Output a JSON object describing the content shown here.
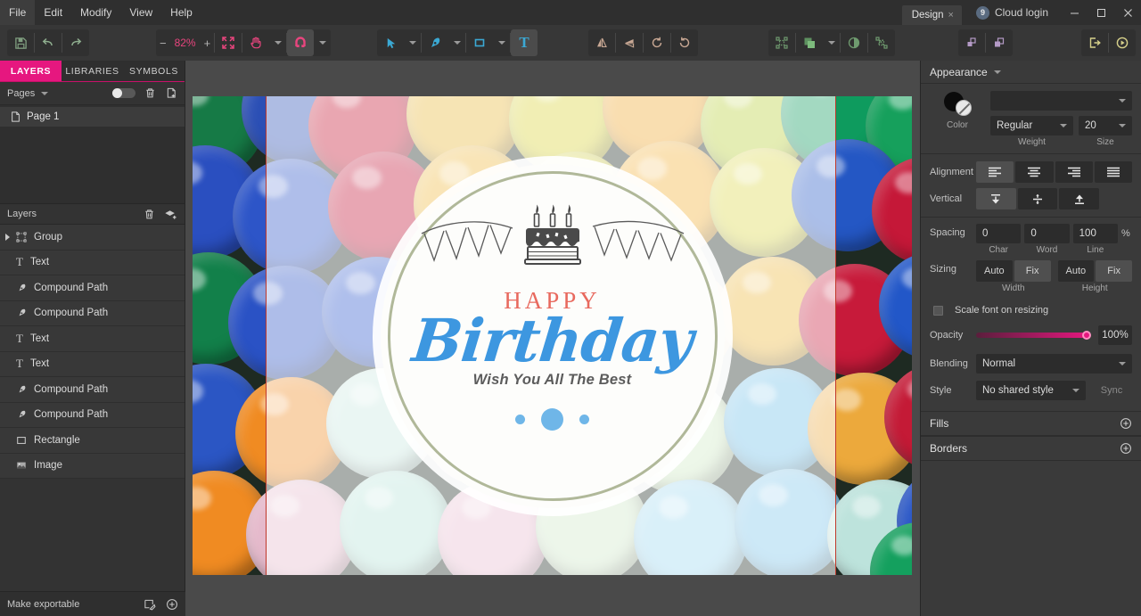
{
  "menu": {
    "items": [
      "File",
      "Edit",
      "Modify",
      "View",
      "Help"
    ],
    "design_tab": "Design",
    "design_tab_close": "×",
    "cloud_login": "Cloud login",
    "cloud_badge": "9",
    "minimize": "—",
    "maximize": "☐",
    "close": "✕"
  },
  "toolbar": {
    "save_icon": "save-icon",
    "undo_icon": "undo-icon",
    "redo_icon": "redo-icon",
    "zoom_minus": "−",
    "zoom_value": "82%",
    "zoom_plus": "+",
    "fit_icon": "fit-to-screen-icon",
    "hand_icon": "hand-tool-icon",
    "magnet_icon": "snap-magnet-icon",
    "select_icon": "select-arrow-icon",
    "pen_icon": "pen-tool-icon",
    "rect_icon": "rectangle-tool-icon",
    "text_icon": "T",
    "flip_h_icon": "flip-horizontal-icon",
    "flip_v_icon": "flip-vertical-icon",
    "rotate_ccw_icon": "rotate-counterclockwise-icon",
    "rotate_cw_icon": "rotate-clockwise-icon",
    "group_icon": "group-icon",
    "arrange_icon": "arrange-icon",
    "mask_icon": "mask-icon",
    "boolean_icon": "boolean-ops-icon",
    "scale_icon": "scale-icon",
    "duplicate_icon": "duplicate-icon",
    "export_icon": "export-icon",
    "preview_icon": "preview-play-icon"
  },
  "left_panel": {
    "tabs": [
      {
        "label": "LAYERS",
        "active": true
      },
      {
        "label": "LIBRARIES",
        "active": false
      },
      {
        "label": "SYMBOLS",
        "active": false
      }
    ],
    "pages_label": "Pages",
    "pages_delete_icon": "trash-icon",
    "pages_add_icon": "add-page-icon",
    "pages": [
      {
        "name": "Page 1",
        "icon": "page-icon"
      }
    ],
    "layers_label": "Layers",
    "layers_delete_icon": "trash-icon",
    "layers_add_icon": "add-layer-icon",
    "layers": [
      {
        "name": "Group",
        "icon": "group-icon",
        "expandable": true
      },
      {
        "name": "Text",
        "icon": "text-icon",
        "expandable": false
      },
      {
        "name": "Compound Path",
        "icon": "path-icon",
        "expandable": false
      },
      {
        "name": "Compound Path",
        "icon": "path-icon",
        "expandable": false
      },
      {
        "name": "Text",
        "icon": "text-icon",
        "expandable": false
      },
      {
        "name": "Text",
        "icon": "text-icon",
        "expandable": false
      },
      {
        "name": "Compound Path",
        "icon": "path-icon",
        "expandable": false
      },
      {
        "name": "Compound Path",
        "icon": "path-icon",
        "expandable": false
      },
      {
        "name": "Rectangle",
        "icon": "rectangle-icon",
        "expandable": false
      },
      {
        "name": "Image",
        "icon": "image-icon",
        "expandable": false
      }
    ],
    "make_exportable": "Make exportable",
    "export_slice_icon": "export-slice-icon",
    "export_add_icon": "plus-circle-icon"
  },
  "canvas": {
    "artwork": {
      "headline": "HAPPY",
      "script": "Birthday",
      "subtitle": "Wish You All The Best",
      "cake_icon": "birthday-cake-icon",
      "bunting_left_icon": "bunting-flags-icon",
      "bunting_right_icon": "bunting-flags-icon",
      "headline_color": "#e8695e",
      "script_color": "#3d97e0",
      "subtitle_color": "#5c5c5c",
      "dot_color": "#6fb6e8"
    }
  },
  "right_panel": {
    "title": "Appearance",
    "collapse_icon": "chevron-down-icon",
    "font_family": "",
    "color_label": "Color",
    "weight_value": "Regular",
    "weight_caption": "Weight",
    "size_value": "20",
    "size_caption": "Size",
    "alignment_label": "Alignment",
    "alignment_options": [
      "align-left-icon",
      "align-center-icon",
      "align-right-icon",
      "align-justify-icon"
    ],
    "alignment_active": 0,
    "vertical_label": "Vertical",
    "vertical_options": [
      "valign-top-icon",
      "valign-middle-icon",
      "valign-bottom-icon"
    ],
    "vertical_active": 0,
    "spacing_label": "Spacing",
    "spacing_char": "0",
    "spacing_word": "0",
    "spacing_line": "100",
    "spacing_unit": "%",
    "spacing_char_caption": "Char",
    "spacing_word_caption": "Word",
    "spacing_line_caption": "Line",
    "sizing_label": "Sizing",
    "width_auto": "Auto",
    "width_fix": "Fix",
    "width_caption": "Width",
    "height_auto": "Auto",
    "height_fix": "Fix",
    "height_caption": "Height",
    "scale_font_label": "Scale font on resizing",
    "opacity_label": "Opacity",
    "opacity_value": "100%",
    "blending_label": "Blending",
    "blending_value": "Normal",
    "style_label": "Style",
    "style_value": "No shared style",
    "sync_label": "Sync",
    "fills_label": "Fills",
    "fills_add_icon": "plus-circle-icon",
    "borders_label": "Borders",
    "borders_add_icon": "plus-circle-icon"
  },
  "colors": {
    "accent_pink": "#e6177f",
    "tool_cyan": "#3ba9d4",
    "zoom_pink": "#e8457e"
  }
}
